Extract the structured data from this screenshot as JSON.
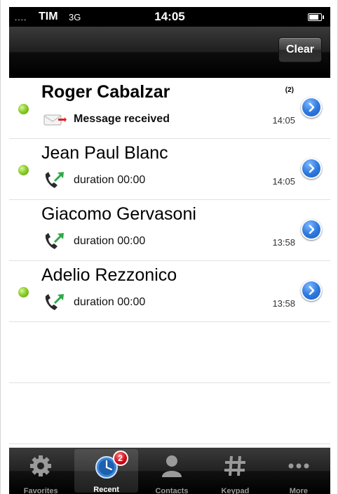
{
  "status_bar": {
    "signal": "....",
    "carrier": "TIM",
    "network": "3G",
    "time": "14:05",
    "battery_icon": "battery-icon"
  },
  "nav_bar": {
    "clear_label": "Clear"
  },
  "recents": [
    {
      "name": "Roger Cabalzar",
      "bold": true,
      "online": true,
      "count": "(2)",
      "type_icon": "message-envelope-icon",
      "detail": "Message received",
      "time": "14:05"
    },
    {
      "name": "Jean Paul Blanc",
      "bold": false,
      "online": true,
      "count": "",
      "type_icon": "outgoing-call-icon",
      "detail": "duration 00:00",
      "time": "14:05"
    },
    {
      "name": "Giacomo Gervasoni",
      "bold": false,
      "online": false,
      "count": "",
      "type_icon": "outgoing-call-icon",
      "detail": "duration 00:00",
      "time": "13:58"
    },
    {
      "name": "Adelio Rezzonico",
      "bold": false,
      "online": true,
      "count": "",
      "type_icon": "outgoing-call-icon",
      "detail": "duration 00:00",
      "time": "13:58"
    }
  ],
  "tab_bar": {
    "tabs": [
      {
        "label": "Favorites",
        "icon": "gear-icon"
      },
      {
        "label": "Recent",
        "icon": "clock-icon",
        "badge": "2",
        "active": true
      },
      {
        "label": "Contacts",
        "icon": "person-icon"
      },
      {
        "label": "Keypad",
        "icon": "keypad-icon"
      },
      {
        "label": "More",
        "icon": "more-dots-icon"
      }
    ]
  },
  "colors": {
    "presence_online": "#8ccf2a",
    "detail_button": "#2f7be0",
    "badge_red": "#d00010",
    "call_arrow_green": "#2fa84a"
  }
}
